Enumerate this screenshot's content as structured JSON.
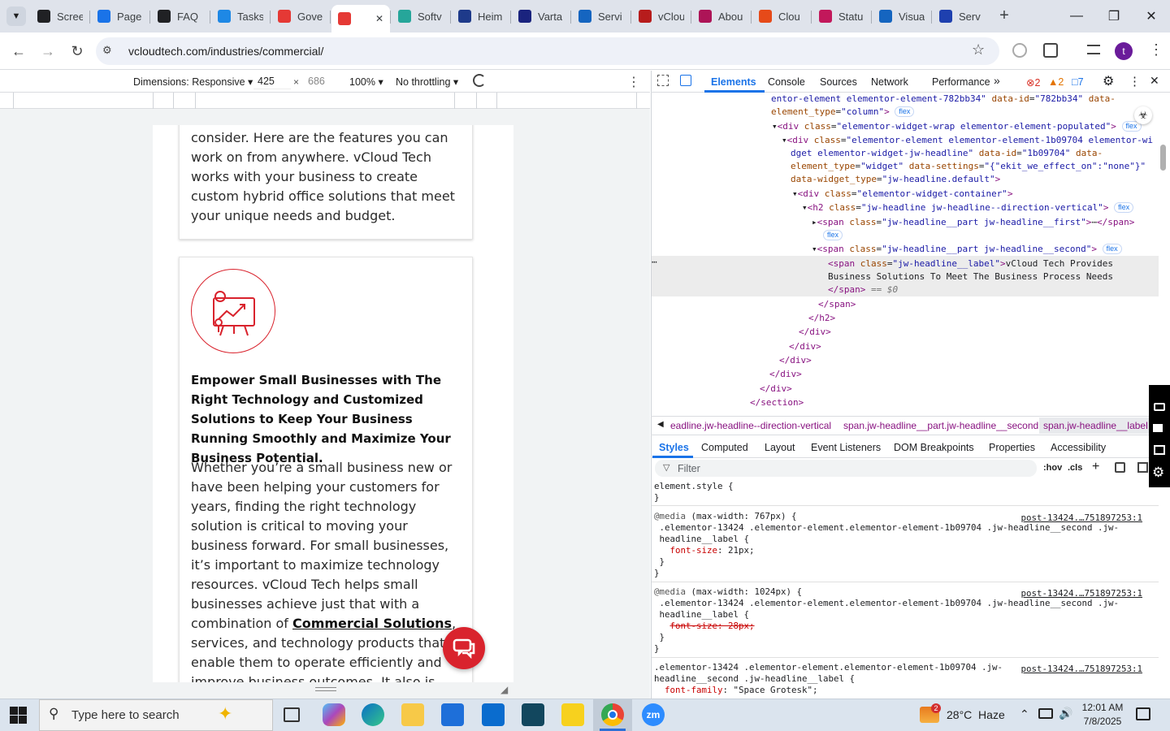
{
  "tabs": [
    "Scree",
    "Page",
    "FAQ",
    "Tasks",
    "Gove",
    "",
    "Softv",
    "Heim",
    "Varta",
    "Servi",
    "vClou",
    "Abou",
    "Clou",
    "Statu",
    "Visua",
    "Serv"
  ],
  "tab_colors": [
    "#202124",
    "#1a73e8",
    "#202124",
    "#1e88e5",
    "#e53935",
    "#e53935",
    "#26a69a",
    "#1e3a8a",
    "#1a237e",
    "#1565c0",
    "#b71c1c",
    "#ad1457",
    "#e64a19",
    "#c2185b",
    "#1565c0",
    "#1e40af"
  ],
  "omnibox": {
    "url": "vcloudtech.com/industries/commercial/"
  },
  "device": {
    "dimensions": "Dimensions: Responsive",
    "width": "425",
    "height": "686",
    "zoom": "100%",
    "throttling": "No throttling"
  },
  "page": {
    "p1": "consider. Here are the features you can work on from anywhere. vCloud Tech works with your business to create custom hybrid office solutions that meet your unique needs and budget.",
    "heading": "Empower Small Businesses with The Right Technology and Customized Solutions to Keep Your Business Running Smoothly and Maximize Your Business Potential.",
    "p2a": "Whether you’re a small business new or have been helping your customers for years, finding the right technology solution is critical to moving your business forward. For small businesses, it’s important to maximize technology resources. vCloud Tech helps small businesses achieve just that with a combination of ",
    "link": "Commercial Solutions",
    "p2b": ", services, and technology products that enable them to operate efficiently and improve business outcomes. It also is"
  },
  "devtools": {
    "tabs": [
      "Elements",
      "Console",
      "Sources",
      "Network",
      "Performance"
    ],
    "errors": "2",
    "warnings": "2",
    "messages": "7",
    "breadcrumbs": [
      "eadline.jw-headline--direction-vertical",
      "span.jw-headline__part.jw-headline__second",
      "span.jw-headline__label"
    ],
    "style_tabs": [
      "Styles",
      "Computed",
      "Layout",
      "Event Listeners",
      "DOM Breakpoints",
      "Properties",
      "Accessibility"
    ],
    "filter_placeholder": "Filter",
    "hov": ":hov",
    "cls": ".cls",
    "source_link": "post-13424.…751897253:1",
    "selected_text": "vCloud Tech Provides Business Solutions To Meet The Business Process Needs"
  },
  "taskbar": {
    "search": "Type here to search",
    "weather": "28°C  Haze",
    "time": "12:01 AM",
    "date": "7/8/2025",
    "badge": "2"
  }
}
